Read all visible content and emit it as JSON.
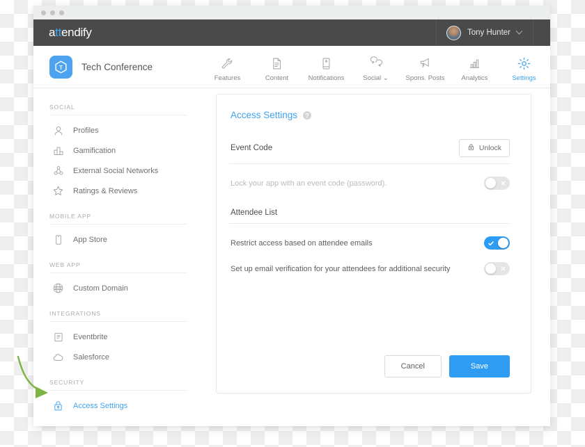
{
  "window": {
    "brand_prefix": "a",
    "brand_tt": "tt",
    "brand_suffix": "endify",
    "user_name": "Tony Hunter"
  },
  "app": {
    "name": "Tech Conference",
    "icon_letter": "T"
  },
  "nav": {
    "items": [
      {
        "label": "Features",
        "icon": "wrench-icon",
        "active": false
      },
      {
        "label": "Content",
        "icon": "document-icon",
        "active": false
      },
      {
        "label": "Notifications",
        "icon": "phone-icon",
        "active": false
      },
      {
        "label": "Social",
        "icon": "chat-bubbles-icon",
        "active": false,
        "caret": "⌄"
      },
      {
        "label": "Spons. Posts",
        "icon": "megaphone-icon",
        "active": false
      },
      {
        "label": "Analytics",
        "icon": "bar-chart-icon",
        "active": false
      },
      {
        "label": "Settings",
        "icon": "gear-icon",
        "active": true
      }
    ]
  },
  "sidebar": {
    "groups": [
      {
        "title": "SOCIAL",
        "items": [
          {
            "label": "Profiles",
            "icon": "person-icon",
            "active": false
          },
          {
            "label": "Gamification",
            "icon": "podium-icon",
            "active": false
          },
          {
            "label": "External Social Networks",
            "icon": "network-icon",
            "active": false
          },
          {
            "label": "Ratings & Reviews",
            "icon": "star-icon",
            "active": false
          }
        ]
      },
      {
        "title": "MOBILE APP",
        "items": [
          {
            "label": "App Store",
            "icon": "mobile-phone-icon",
            "active": false
          }
        ]
      },
      {
        "title": "WEB APP",
        "items": [
          {
            "label": "Custom Domain",
            "icon": "globe-www-icon",
            "active": false
          }
        ]
      },
      {
        "title": "INTEGRATIONS",
        "items": [
          {
            "label": "Eventbrite",
            "icon": "ticket-icon",
            "active": false
          },
          {
            "label": "Salesforce",
            "icon": "cloud-icon",
            "active": false
          }
        ]
      },
      {
        "title": "SECURITY",
        "items": [
          {
            "label": "Access Settings",
            "icon": "lock-icon",
            "active": true
          }
        ]
      }
    ]
  },
  "main": {
    "title": "Access Settings",
    "help_badge": "?",
    "sections": [
      {
        "label": "Event Code",
        "action_label": "Unlock",
        "action_icon": "lock-icon",
        "rows": [
          {
            "label": "Lock your app with an event code (password).",
            "muted": true,
            "toggle": "off"
          }
        ]
      },
      {
        "label": "Attendee List",
        "rows": [
          {
            "label": "Restrict access based on attendee emails",
            "muted": false,
            "toggle": "on"
          },
          {
            "label": "Set up email verification for your attendees for additional security",
            "muted": false,
            "toggle": "off"
          }
        ]
      }
    ],
    "cancel_label": "Cancel",
    "save_label": "Save"
  },
  "annotation": {
    "arrow_color": "#7cb342",
    "points_to": "Access Settings"
  },
  "colors": {
    "accent": "#2f9cf4",
    "topbar": "#4a4a4a",
    "arrow_green": "#7cb342"
  }
}
